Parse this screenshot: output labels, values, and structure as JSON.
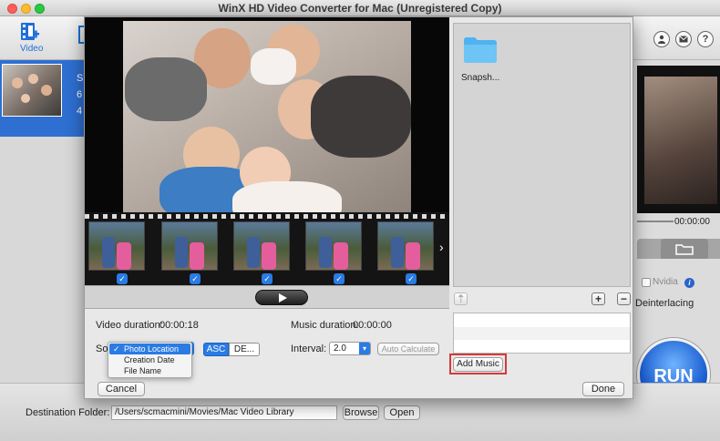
{
  "window": {
    "title": "WinX HD Video Converter for Mac (Unregistered Copy)",
    "traffic_light_colors": [
      "#fc5f57",
      "#fdbc2e",
      "#29c941"
    ]
  },
  "toolbar": {
    "video_label": "Video",
    "video_icon": "film-add-icon",
    "user_icon": "user-icon",
    "mail_icon": "mail-icon",
    "help_icon": "help-icon",
    "help_glyph": "?"
  },
  "left_list": {
    "item_text_fragments": [
      "S",
      "6",
      "4"
    ]
  },
  "right_panel": {
    "time": "00:00:00",
    "nvidia_label": "Nvidia",
    "deinterlacing_label": "Deinterlacing",
    "run_label": "RUN",
    "folder_icon": "folder-icon"
  },
  "bottom": {
    "destination_label": "Destination Folder:",
    "destination_value": "/Users/scmacmini/Movies/Mac Video Library",
    "browse_label": "Browse",
    "open_label": "Open"
  },
  "dialog": {
    "snapshot_folder_name": "Snapsh...",
    "thumbnails": [
      {
        "checked": true
      },
      {
        "checked": true
      },
      {
        "checked": true
      },
      {
        "checked": true
      },
      {
        "checked": true
      }
    ],
    "video_duration_label": "Video duration:",
    "video_duration_value": "00:00:18",
    "music_duration_label": "Music duration:",
    "music_duration_value": "00:00:00",
    "sort_label_visible": "Sor",
    "sort_options": [
      "Photo Location",
      "Creation Date",
      "File Name"
    ],
    "sort_selected": "Photo Location",
    "asc_label": "ASC",
    "desc_label": "DE...",
    "interval_label": "Interval:",
    "interval_value": "2.0",
    "auto_calculate_label": "Auto Calculate",
    "add_music_label": "Add Music",
    "cancel_label": "Cancel",
    "done_label": "Done",
    "accent_color": "#2a7be4",
    "highlight_color": "#d33a3a"
  }
}
